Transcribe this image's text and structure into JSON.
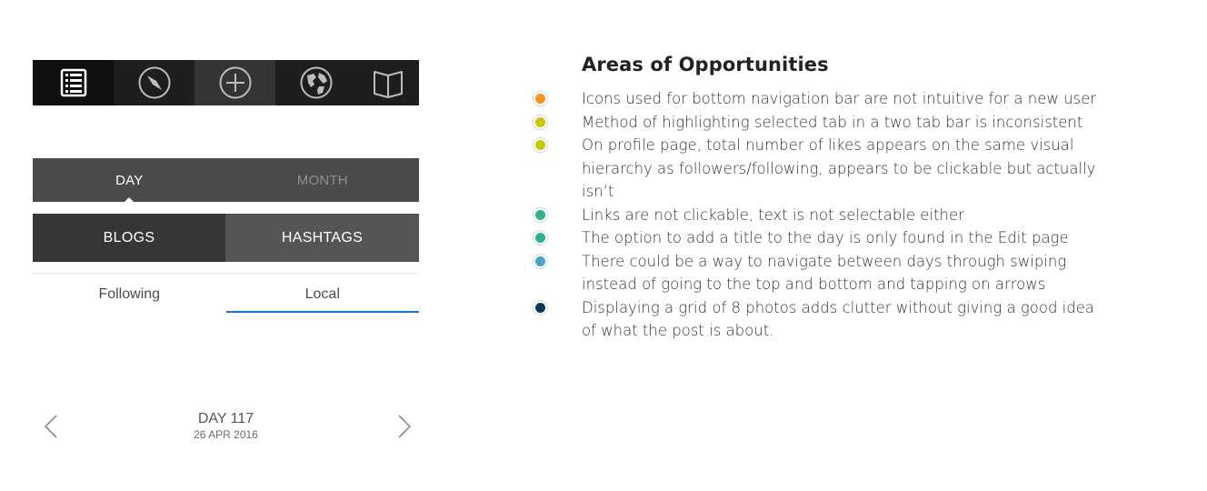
{
  "nav": {
    "icons": [
      "feed-icon",
      "compass-icon",
      "add-icon",
      "globe-icon",
      "book-icon"
    ]
  },
  "day_tabs": {
    "day": "DAY",
    "month": "MONTH"
  },
  "content_tabs": {
    "blogs": "BLOGS",
    "hashtags": "HASHTAGS"
  },
  "feed_tabs": {
    "following": "Following",
    "local": "Local"
  },
  "day_nav": {
    "title": "DAY 117",
    "date": "26 APR 2016"
  },
  "opportunities": {
    "title": "Areas of Opportunities",
    "items": [
      {
        "text": "Icons used for bottom navigation bar are not intuitive for a new user",
        "color": "#f7941d"
      },
      {
        "text": "Method of highlighting selected tab in a two tab bar is inconsistent",
        "color": "#c8c800"
      },
      {
        "text": "On profile page, total number of likes appears on the same visual hierarchy as followers/following, appears to be clickable but actually isn’t",
        "color": "#c8c800"
      },
      {
        "text": "Links are not clickable, text is not selectable either",
        "color": "#2cb28f"
      },
      {
        "text": "The option to add a title to the day is only found in the Edit page",
        "color": "#2cb28f"
      },
      {
        "text": "There could be a way to navigate between days through swiping instead of going to the top and bottom and tapping on arrows",
        "color": "#4aa6c4"
      },
      {
        "text": "Displaying a grid of 8 photos adds clutter without giving a good idea of what the post is about.",
        "color": "#0d3558"
      }
    ]
  }
}
